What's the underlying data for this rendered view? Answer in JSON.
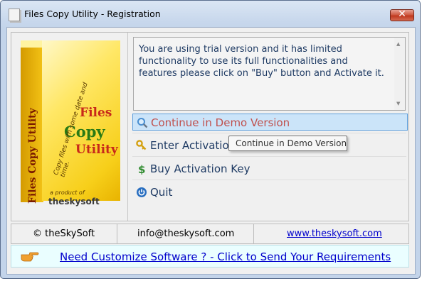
{
  "window": {
    "title": "Files Copy Utility - Registration"
  },
  "product_box": {
    "spine": "Files Copy Utility",
    "line1": "Files",
    "line2": "Copy",
    "line3": "Utility",
    "tagline": "Copy files with some date and time.",
    "product_of": "a product of",
    "brand": "theskysoft"
  },
  "message": "You are using trial version and it has limited functionality to use its full functionalities and features please click on \"Buy\" button and Activate it.",
  "options": [
    {
      "label": "Continue in Demo Version",
      "icon": "magnifier-icon",
      "selected": true
    },
    {
      "label": "Enter Activation",
      "icon": "key-icon",
      "selected": false
    },
    {
      "label": "Buy Activation Key",
      "icon": "dollar-icon",
      "selected": false
    },
    {
      "label": "Quit",
      "icon": "power-icon",
      "selected": false
    }
  ],
  "tooltip": "Continue in Demo Version",
  "footer": {
    "copyright": "© theSkySoft",
    "email": "info@theskysoft.com",
    "website": "www.theskysoft.com"
  },
  "requirements_link": "Need Customize Software ? - Click to Send Your Requirements",
  "colors": {
    "selected_text": "#c0504d",
    "option_text": "#1f3b64",
    "link": "#0000cc",
    "close_red": "#c0391f"
  }
}
